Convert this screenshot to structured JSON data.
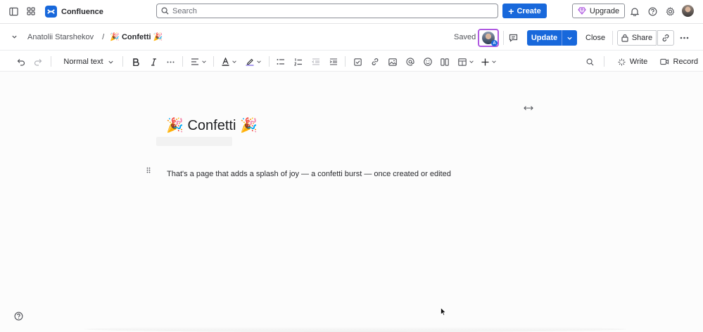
{
  "topnav": {
    "app_name": "Confluence",
    "search_placeholder": "Search",
    "create_label": "Create",
    "upgrade_label": "Upgrade",
    "icons": [
      "sidebar-toggle-icon",
      "app-switcher-icon",
      "confluence-logo-icon",
      "search-icon",
      "plus-icon",
      "gem-icon",
      "bell-icon",
      "help-icon",
      "gear-icon",
      "avatar"
    ]
  },
  "pagebar": {
    "breadcrumb_space": "Anatolii Starshekov",
    "breadcrumb_separator": "/",
    "breadcrumb_page": "🎉 Confetti 🎉",
    "saved_label": "Saved",
    "collaborator_badge": "A",
    "update_label": "Update",
    "close_label": "Close",
    "share_label": "Share"
  },
  "toolbar": {
    "text_style": "Normal text",
    "write_label": "Write",
    "record_label": "Record"
  },
  "page": {
    "title": "🎉 Confetti 🎉",
    "body": "That's a page that adds a splash of joy — a confetti burst — once created or edited"
  },
  "colors": {
    "brand_blue": "#1868db",
    "collab_border": "#af59e1",
    "text": "#292a2e"
  }
}
